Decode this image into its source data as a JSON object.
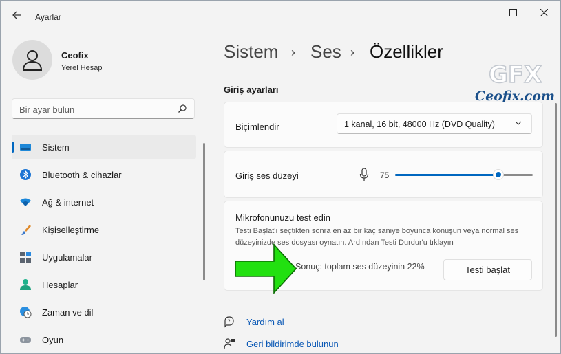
{
  "window": {
    "title": "Ayarlar",
    "controls": {
      "minimize": "minimize-icon",
      "maximize": "maximize-icon",
      "close": "close-icon"
    }
  },
  "profile": {
    "name": "Ceofix",
    "account_type": "Yerel Hesap"
  },
  "search": {
    "placeholder": "Bir ayar bulun"
  },
  "nav": {
    "items": [
      {
        "label": "Sistem",
        "icon": "monitor-icon",
        "active": true
      },
      {
        "label": "Bluetooth & cihazlar",
        "icon": "bluetooth-icon"
      },
      {
        "label": "Ağ & internet",
        "icon": "wifi-icon"
      },
      {
        "label": "Kişiselleştirme",
        "icon": "brush-icon"
      },
      {
        "label": "Uygulamalar",
        "icon": "apps-icon"
      },
      {
        "label": "Hesaplar",
        "icon": "person-icon"
      },
      {
        "label": "Zaman ve dil",
        "icon": "globe-clock-icon"
      },
      {
        "label": "Oyun",
        "icon": "gamepad-icon"
      }
    ]
  },
  "breadcrumb": {
    "items": [
      "Sistem",
      "Ses",
      "Özellikler"
    ],
    "separator": "›"
  },
  "input_settings": {
    "title": "Giriş ayarları",
    "format": {
      "label": "Biçimlendir",
      "value": "1 kanal, 16 bit, 48000 Hz (DVD Quality)"
    },
    "volume": {
      "label": "Giriş ses düzeyi",
      "value": "75",
      "level": 0.75
    },
    "test": {
      "title": "Mikrofonunuzu test edin",
      "description": "Testi Başlat'ı seçtikten sonra en az bir kaç saniye boyunca konuşun veya normal ses düzeyinizde ses dosyası oynatın. Ardından Testi Durdur'u tıklayın",
      "result": "Sonuç: toplam ses düzeyinin 22%",
      "button": "Testi başlat"
    }
  },
  "links": {
    "help": "Yardım al",
    "feedback": "Geri bildirimde bulunun"
  },
  "watermark": {
    "text": "Ceofix.com",
    "logo": "GFX"
  },
  "colors": {
    "accent": "#0067c0",
    "arrow": "#22e010",
    "link": "#0a58b5"
  }
}
